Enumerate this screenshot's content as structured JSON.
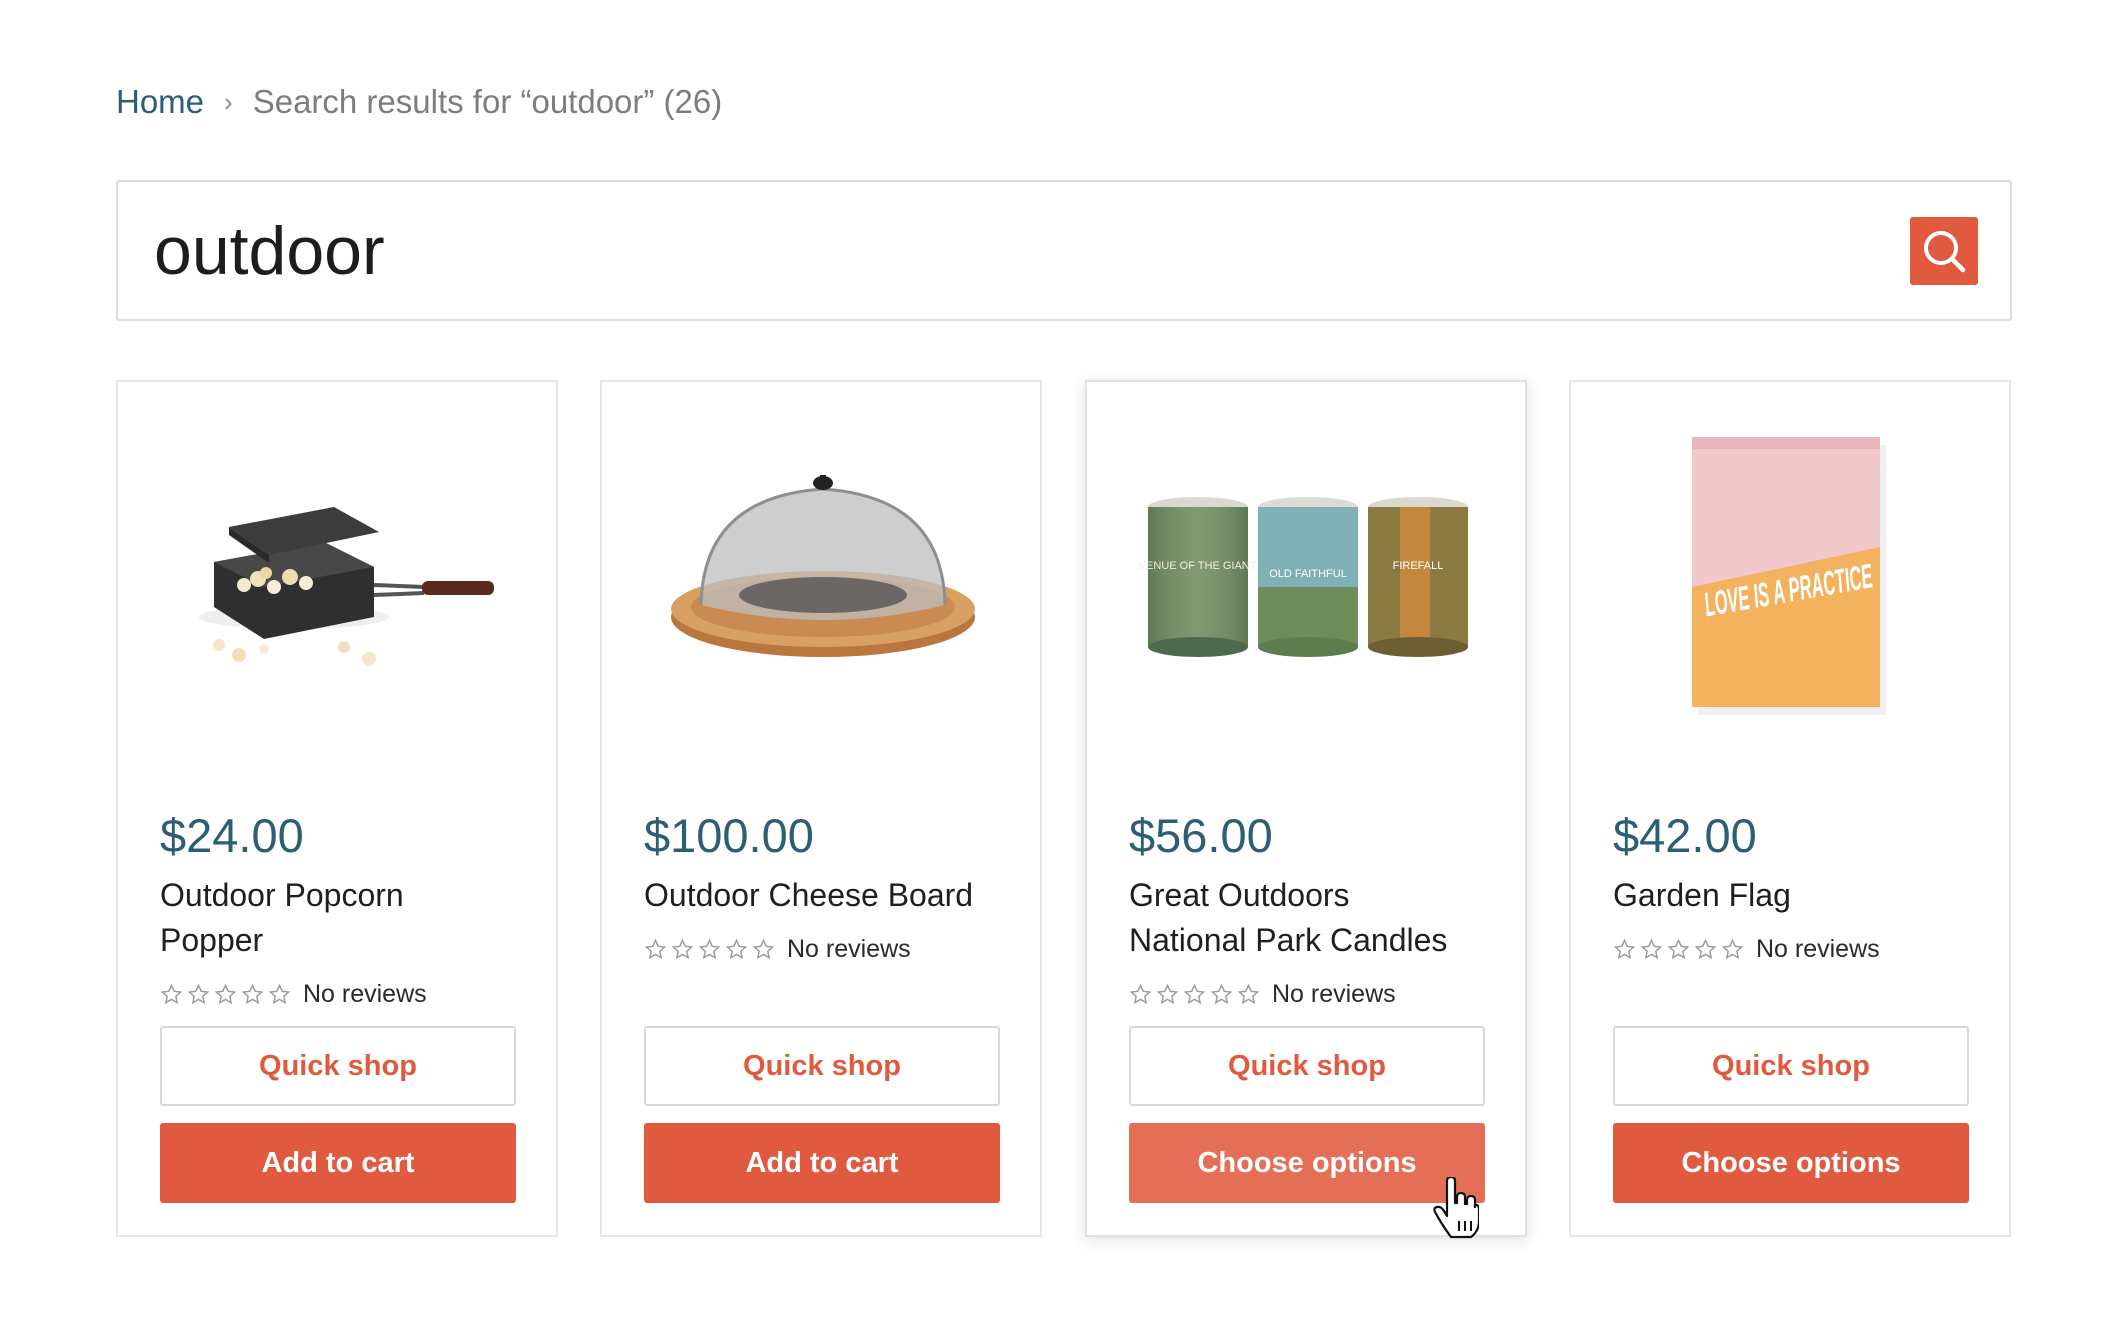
{
  "breadcrumb": {
    "home_label": "Home",
    "separator": "›",
    "current": "Search results for “outdoor” (26)"
  },
  "search": {
    "value": "outdoor",
    "button_icon": "search-icon"
  },
  "colors": {
    "accent": "#e05a3f",
    "price": "#2c5f73",
    "link": "#2c5f73"
  },
  "products": [
    {
      "price": "$24.00",
      "title": "Outdoor Popcorn Popper",
      "reviews": "No reviews",
      "rating_stars": 0,
      "quick_label": "Quick shop",
      "action_label": "Add to cart"
    },
    {
      "price": "$100.00",
      "title": "Outdoor Cheese Board",
      "reviews": "No reviews",
      "rating_stars": 0,
      "quick_label": "Quick shop",
      "action_label": "Add to cart"
    },
    {
      "price": "$56.00",
      "title": "Great Outdoors National Park Candles",
      "reviews": "No reviews",
      "rating_stars": 0,
      "quick_label": "Quick shop",
      "action_label": "Choose options",
      "image_labels": [
        "AVENUE OF THE GIANTS",
        "OLD FAITHFUL",
        "FIREFALL"
      ]
    },
    {
      "price": "$42.00",
      "title": "Garden Flag",
      "reviews": "No reviews",
      "rating_stars": 0,
      "quick_label": "Quick shop",
      "action_label": "Choose options",
      "image_labels": [
        "LOVE IS A PRACTICE"
      ]
    }
  ]
}
